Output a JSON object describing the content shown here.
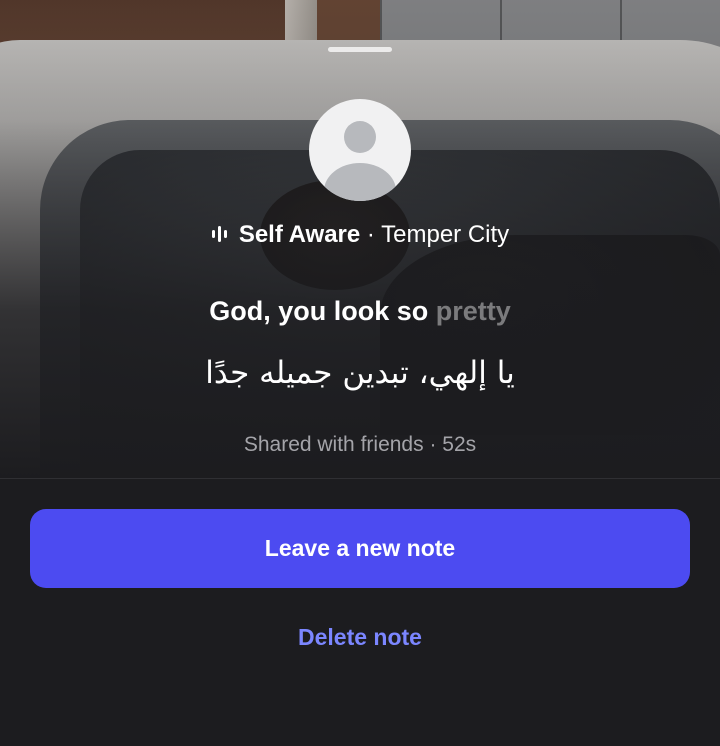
{
  "sheet": {
    "song": {
      "title": "Self Aware",
      "separator": " · ",
      "artist": "Temper City",
      "icon": "audio-bars-icon"
    },
    "lyric": {
      "sung": "God, you look so ",
      "unsung": "pretty"
    },
    "note_text": "يا إلهي، تبدين جميله جدًا",
    "meta": "Shared with friends · 52s",
    "actions": {
      "primary_label": "Leave a new note",
      "secondary_label": "Delete note"
    }
  },
  "colors": {
    "background": "#1c1c1f",
    "primary_button": "#4c4bf1",
    "link": "#7b86ff",
    "meta_text": "#a4a4a9"
  }
}
